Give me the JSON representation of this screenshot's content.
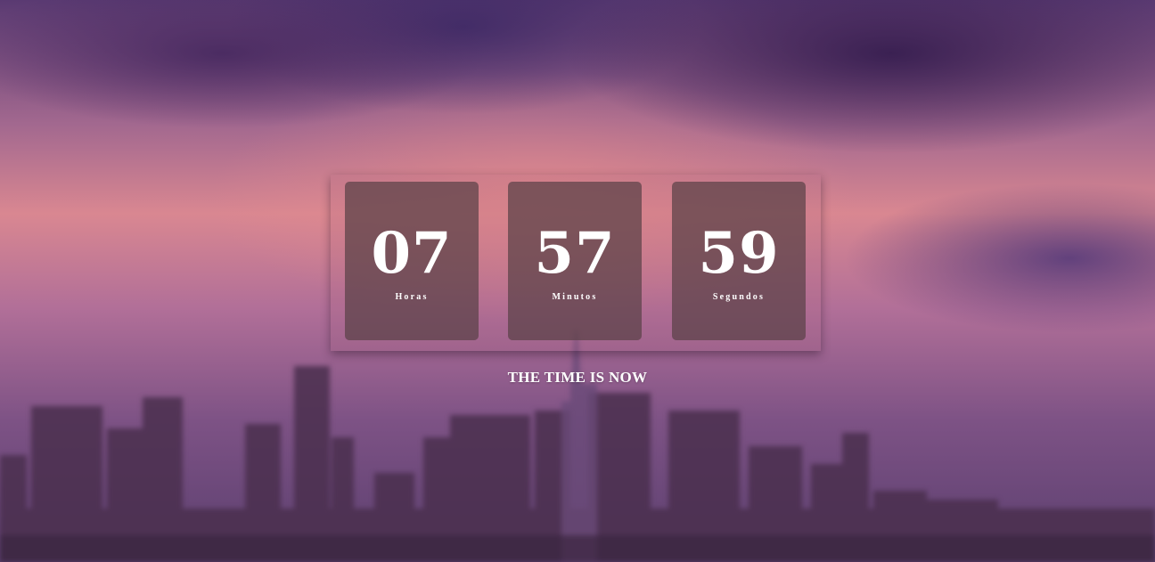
{
  "countdown": {
    "hours": {
      "value": "07",
      "label": "Horas"
    },
    "minutes": {
      "value": "57",
      "label": "Minutos"
    },
    "seconds": {
      "value": "59",
      "label": "Segundos"
    }
  },
  "tagline": "THE TIME IS NOW",
  "colors": {
    "tile_background": "#5a4146",
    "text": "#ffffff",
    "sky_top": "#5a3a72",
    "sky_glow": "#d98791"
  }
}
